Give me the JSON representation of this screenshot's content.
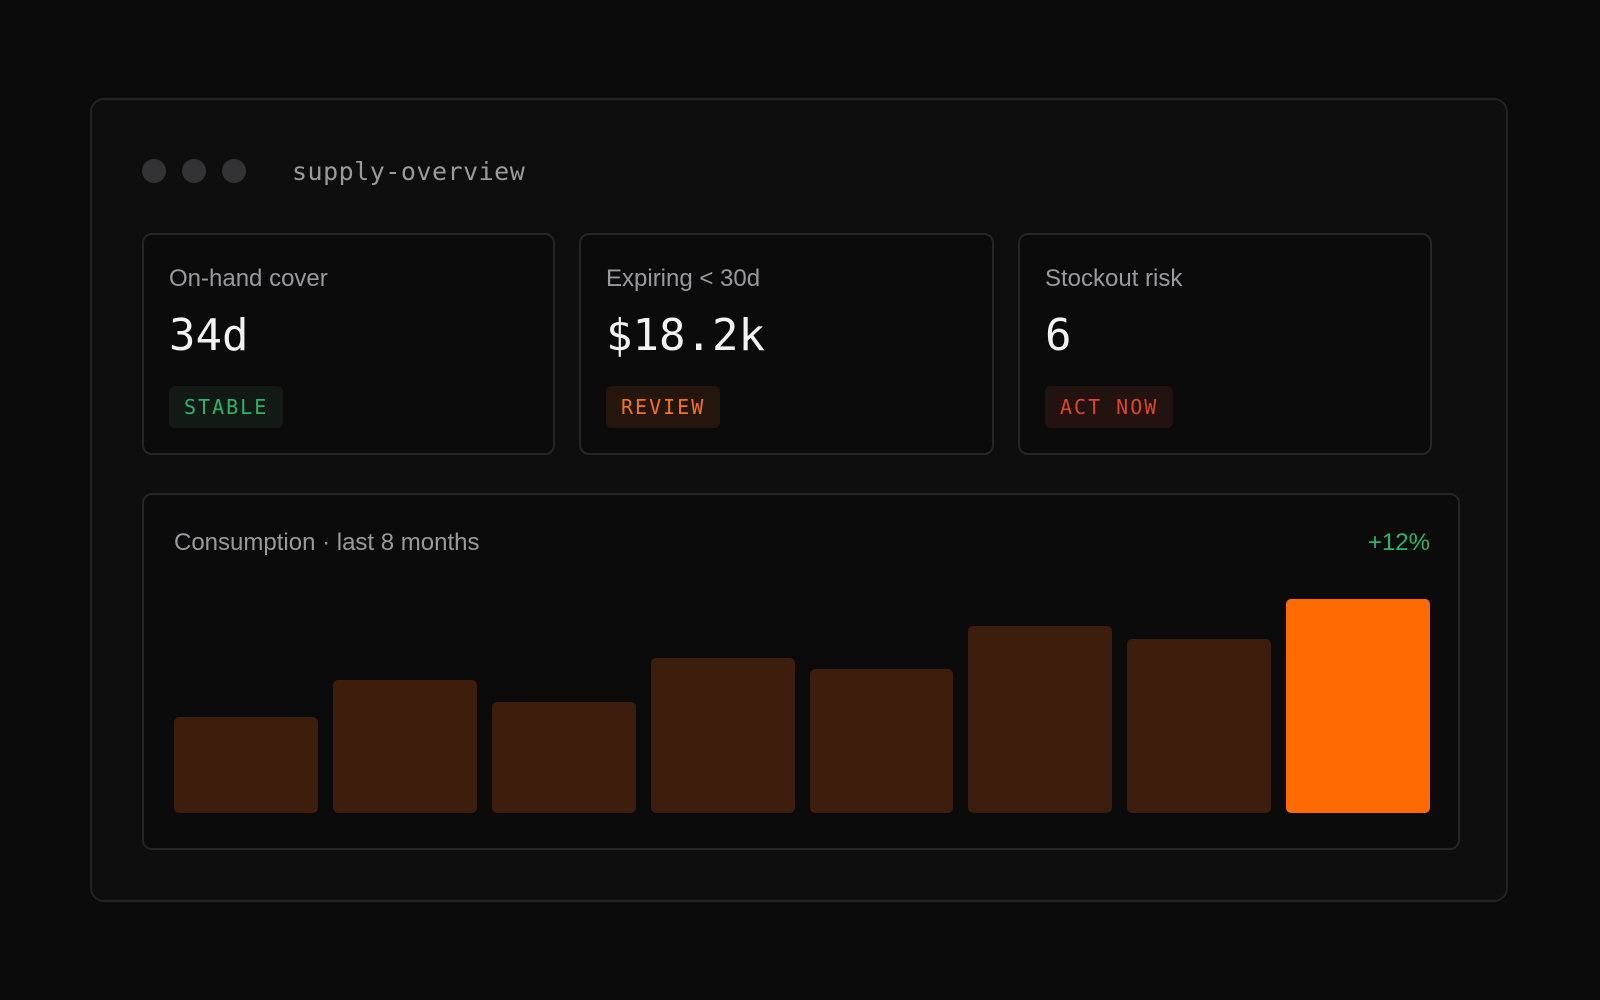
{
  "window": {
    "title": "supply-overview",
    "controls": [
      "close",
      "minimize",
      "maximize"
    ]
  },
  "cards": [
    {
      "label": "On-hand cover",
      "value": "34d",
      "badge": "STABLE",
      "badge_color": "#2fb36b",
      "badge_bg": "#131a15"
    },
    {
      "label": "Expiring < 30d",
      "value": "$18.2k",
      "badge": "REVIEW",
      "badge_color": "#f5731a",
      "badge_bg": "#24160d"
    },
    {
      "label": "Stockout risk",
      "value": "6",
      "badge": "ACT NOW",
      "badge_color": "#e0442a",
      "badge_bg": "#231310"
    }
  ],
  "chart": {
    "title": "Consumption · last 8 months",
    "change": "+12%",
    "change_color": "#2fb36b"
  },
  "chart_data": {
    "type": "bar",
    "title": "Consumption · last 8 months",
    "values": [
      44,
      61,
      51,
      71,
      66,
      86,
      80,
      98
    ],
    "ylim": [
      0,
      100
    ],
    "bar_color": "#3d1d0b",
    "highlight_color": "#ff6b00",
    "highlight_index": 7,
    "grid": false,
    "legend": "none"
  }
}
